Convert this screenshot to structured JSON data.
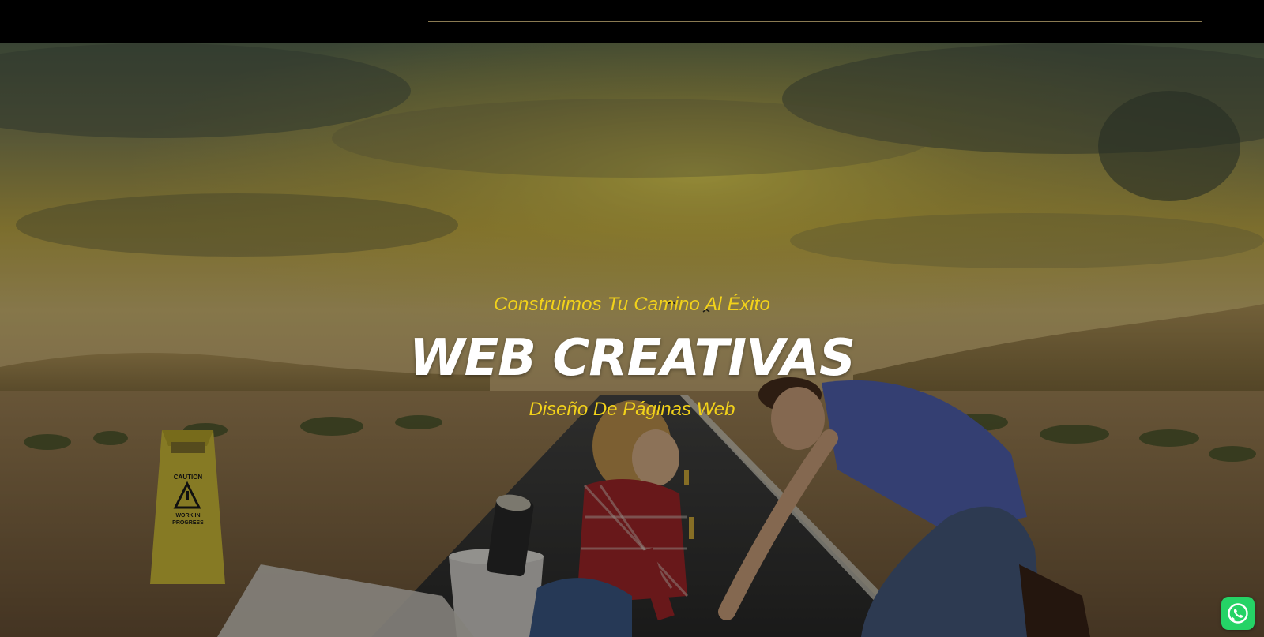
{
  "hero": {
    "tagline": "Construimos Tu Camino Al Éxito",
    "title": "WEB CREATIVAS",
    "subtitle": "Diseño De Páginas Web",
    "caution_sign": {
      "line1": "CAUTION",
      "line2": "WORK IN",
      "line3": "PROGRESS"
    }
  },
  "colors": {
    "tagline": "#f2d21a",
    "title": "#ffffff",
    "topbar": "#000000",
    "topbar_rule": "#8a7a52",
    "whatsapp": "#25d366"
  },
  "floating": {
    "whatsapp_icon": "whatsapp-icon"
  }
}
